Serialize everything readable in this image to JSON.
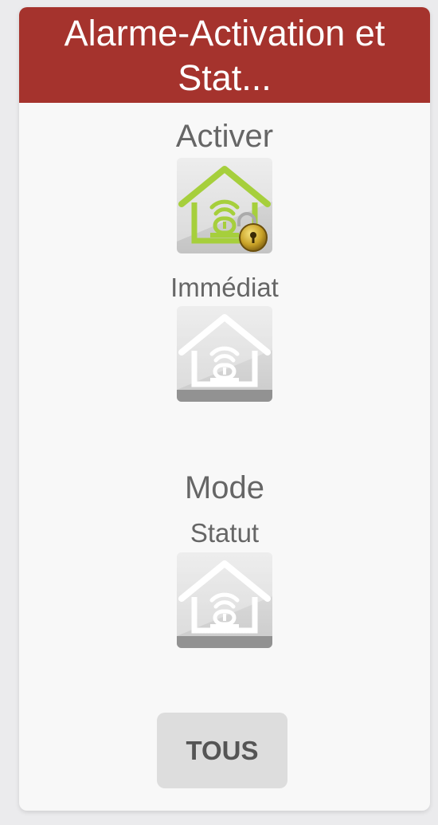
{
  "widget": {
    "title": "Alarme-Activation et Stat...",
    "header_color": "#a5332d"
  },
  "activer": {
    "label": "Activer",
    "icon": "house-siren-lock-icon",
    "accent": "#a6cf3c"
  },
  "immediat": {
    "label": "Immédiat",
    "icon": "house-siren-icon"
  },
  "mode": {
    "label": "Mode"
  },
  "statut": {
    "label": "Statut",
    "icon": "house-siren-icon"
  },
  "tous_button": {
    "label": "TOUS"
  }
}
